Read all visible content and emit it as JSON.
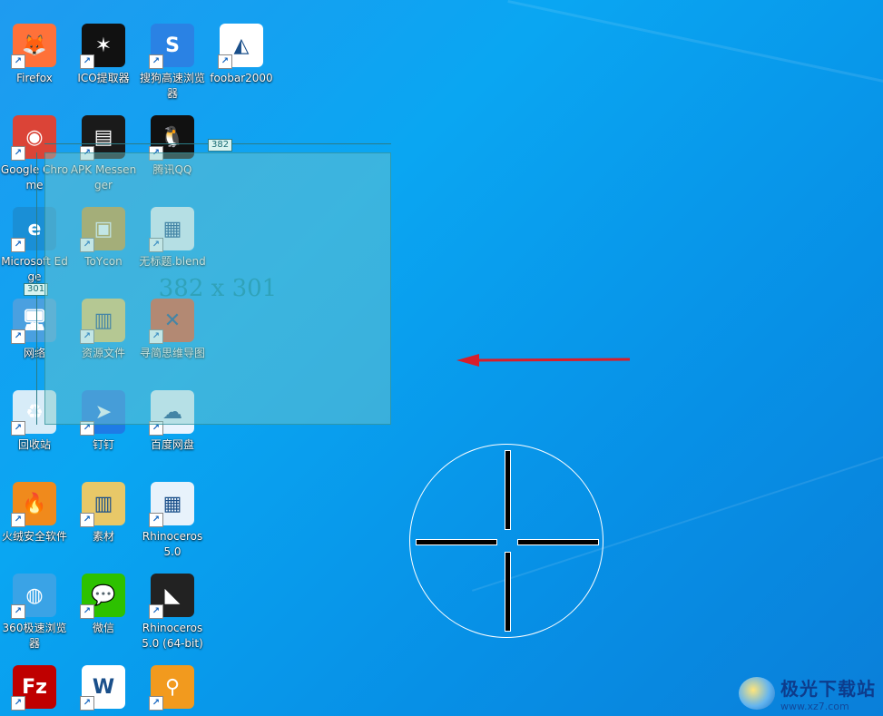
{
  "desktop": {
    "icons": [
      {
        "label": "Firefox",
        "icon": "firefox-icon",
        "color": "#ff7139",
        "glyph": "🦊"
      },
      {
        "label": "ICO提取器",
        "icon": "ico-extractor-icon",
        "color": "#111111",
        "glyph": "✶"
      },
      {
        "label": "搜狗高速浏览器",
        "icon": "sogou-browser-icon",
        "color": "#2a82e4",
        "glyph": "S"
      },
      {
        "label": "foobar2000",
        "icon": "foobar2000-icon",
        "color": "#ffffff",
        "glyph": "◭"
      },
      {
        "label": "Google Chrome",
        "icon": "chrome-icon",
        "color": "#db4437",
        "glyph": "◉"
      },
      {
        "label": "APK Messenger",
        "icon": "apk-messenger-icon",
        "color": "#1a1a1a",
        "glyph": "▤"
      },
      {
        "label": "腾讯QQ",
        "icon": "qq-icon",
        "color": "#111111",
        "glyph": "🐧"
      },
      {
        "label": "Microsoft Edge",
        "icon": "edge-icon",
        "color": "#1a8fd6",
        "glyph": "e"
      },
      {
        "label": "ToYcon",
        "icon": "toycon-icon",
        "color": "#c89a3a",
        "glyph": "▣"
      },
      {
        "label": "无标题.blend",
        "icon": "blend-file-icon",
        "color": "#e8f2fb",
        "glyph": "▦"
      },
      {
        "label": "网络",
        "icon": "network-icon",
        "color": "#4aa0e0",
        "glyph": "🖥"
      },
      {
        "label": "资源文件",
        "icon": "folder-icon",
        "color": "#e8c868",
        "glyph": "▥"
      },
      {
        "label": "寻简思维导图",
        "icon": "mindmap-icon",
        "color": "#e4572e",
        "glyph": "✕"
      },
      {
        "label": "回收站",
        "icon": "recycle-bin-icon",
        "color": "#d7ecf8",
        "glyph": "♻"
      },
      {
        "label": "钉钉",
        "icon": "dingtalk-icon",
        "color": "#1e7be6",
        "glyph": "➤"
      },
      {
        "label": "百度网盘",
        "icon": "baidu-netdisk-icon",
        "color": "#e9f4ff",
        "glyph": "☁"
      },
      {
        "label": "火绒安全软件",
        "icon": "huorong-icon",
        "color": "#f08a1c",
        "glyph": "🔥"
      },
      {
        "label": "素材",
        "icon": "folder-icon",
        "color": "#e8c868",
        "glyph": "▥"
      },
      {
        "label": "Rhinoceros 5.0",
        "icon": "rhino-icon",
        "color": "#e8f2fb",
        "glyph": "▦"
      },
      {
        "label": "360极速浏览器",
        "icon": "360-browser-icon",
        "color": "#3aa3e6",
        "glyph": "◍"
      },
      {
        "label": "微信",
        "icon": "wechat-icon",
        "color": "#2dc100",
        "glyph": "💬"
      },
      {
        "label": "Rhinoceros 5.0 (64-bit)",
        "icon": "rhino64-icon",
        "color": "#222222",
        "glyph": "◣"
      },
      {
        "label": "",
        "icon": "filezilla-icon",
        "color": "#bf0000",
        "glyph": "Fz"
      },
      {
        "label": "",
        "icon": "wps-icon",
        "color": "#ffffff",
        "glyph": "W"
      },
      {
        "label": "",
        "icon": "search-tool-icon",
        "color": "#f29a1e",
        "glyph": "⚲"
      }
    ]
  },
  "selection": {
    "width": "382",
    "height": "301",
    "size_label": "382 x 301"
  },
  "watermark": {
    "title": "极光下载站",
    "url": "www.xz7.com"
  },
  "colors": {
    "arrow": "#d81e2a",
    "selection_fill": "#78c8c8"
  }
}
